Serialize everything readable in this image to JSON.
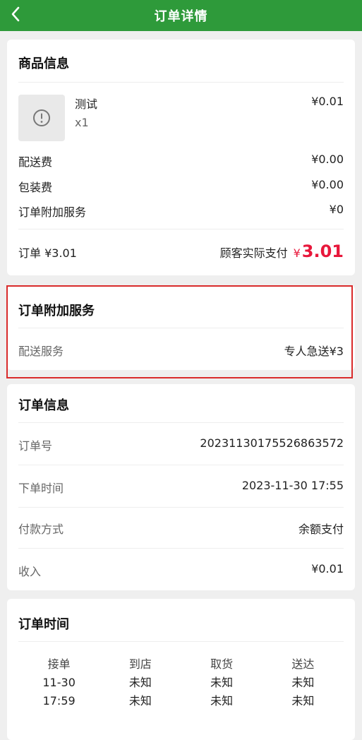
{
  "header": {
    "title": "订单详情"
  },
  "goods": {
    "title": "商品信息",
    "item": {
      "name": "测试",
      "qty": "x1",
      "price": "¥0.01",
      "thumb_icon": "alert-circle-icon"
    },
    "rows": [
      {
        "label": "配送费",
        "value": "¥0.00"
      },
      {
        "label": "包装费",
        "value": "¥0.00"
      },
      {
        "label": "订单附加服务",
        "value": "¥0"
      }
    ],
    "order_total": "订单 ¥3.01",
    "pay_label": "顾客实际支付",
    "pay_yen": "¥",
    "pay_amount": "3.01"
  },
  "extra_service": {
    "title": "订单附加服务",
    "label": "配送服务",
    "value": "专人急送¥3"
  },
  "order_info": {
    "title": "订单信息",
    "rows": [
      {
        "label": "订单号",
        "value": "20231130175526863572"
      },
      {
        "label": "下单时间",
        "value": "2023-11-30 17:55"
      },
      {
        "label": "付款方式",
        "value": "余额支付"
      },
      {
        "label": "收入",
        "value": "¥0.01"
      }
    ]
  },
  "order_time": {
    "title": "订单时间",
    "columns": [
      {
        "label": "接单",
        "line1": "11-30",
        "line2": "17:59"
      },
      {
        "label": "到店",
        "line1": "未知",
        "line2": "未知"
      },
      {
        "label": "取货",
        "line1": "未知",
        "line2": "未知"
      },
      {
        "label": "送达",
        "line1": "未知",
        "line2": "未知"
      }
    ]
  },
  "colors": {
    "header_bg": "#2e9a3a",
    "accent_red": "#e8173b",
    "highlight_border": "#d92b2b"
  }
}
